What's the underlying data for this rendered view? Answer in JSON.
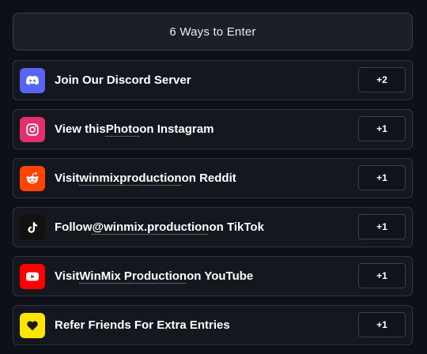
{
  "header": {
    "title": "6 Ways to Enter"
  },
  "entries": [
    {
      "icon": "discord-icon",
      "icon_bg": "#5865f2",
      "text_before": "Join Our Discord Server",
      "link_text": "",
      "text_after": "",
      "points": "+2"
    },
    {
      "icon": "instagram-icon",
      "icon_bg": "#e1306c",
      "text_before": "View this ",
      "link_text": "Photo",
      "text_after": " on Instagram",
      "points": "+1"
    },
    {
      "icon": "reddit-icon",
      "icon_bg": "#ff4500",
      "text_before": "Visit ",
      "link_text": "winmixproduction",
      "text_after": " on Reddit",
      "points": "+1"
    },
    {
      "icon": "tiktok-icon",
      "icon_bg": "#111111",
      "text_before": "Follow ",
      "link_text": "@winmix.production",
      "text_after": " on TikTok",
      "points": "+1"
    },
    {
      "icon": "youtube-icon",
      "icon_bg": "#ff0000",
      "text_before": "Visit ",
      "link_text": "WinMix Production",
      "text_after": " on YouTube",
      "points": "+1"
    },
    {
      "icon": "heart-icon",
      "icon_bg": "#ffe600",
      "text_before": "Refer Friends For Extra Entries",
      "link_text": "",
      "text_after": "",
      "points": "+1"
    }
  ]
}
